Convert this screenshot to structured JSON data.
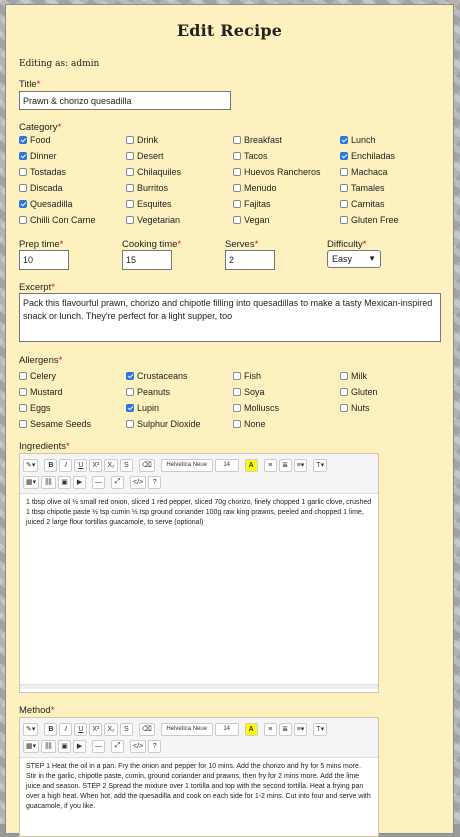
{
  "page_title": "Edit Recipe",
  "editing_as": "Editing as: admin",
  "title_field": {
    "label": "Title",
    "value": "Prawn & chorizo quesadilla"
  },
  "category": {
    "label": "Category",
    "items": [
      {
        "label": "Food",
        "checked": true
      },
      {
        "label": "Drink",
        "checked": false
      },
      {
        "label": "Breakfast",
        "checked": false
      },
      {
        "label": "Lunch",
        "checked": true
      },
      {
        "label": "Dinner",
        "checked": true
      },
      {
        "label": "Desert",
        "checked": false
      },
      {
        "label": "Tacos",
        "checked": false
      },
      {
        "label": "Enchiladas",
        "checked": true
      },
      {
        "label": "Tostadas",
        "checked": false
      },
      {
        "label": "Chilaquiles",
        "checked": false
      },
      {
        "label": "Huevos Rancheros",
        "checked": false
      },
      {
        "label": "Machaca",
        "checked": false
      },
      {
        "label": "Discada",
        "checked": false
      },
      {
        "label": "Burritos",
        "checked": false
      },
      {
        "label": "Menudo",
        "checked": false
      },
      {
        "label": "Tamales",
        "checked": false
      },
      {
        "label": "Quesadilla",
        "checked": true
      },
      {
        "label": "Esquites",
        "checked": false
      },
      {
        "label": "Fajitas",
        "checked": false
      },
      {
        "label": "Carnitas",
        "checked": false
      },
      {
        "label": "Chilli Con Carne",
        "checked": false
      },
      {
        "label": "Vegetarian",
        "checked": false
      },
      {
        "label": "Vegan",
        "checked": false
      },
      {
        "label": "Gluten Free",
        "checked": false
      }
    ]
  },
  "prep": {
    "label": "Prep time",
    "value": "10"
  },
  "cooking": {
    "label": "Cooking time",
    "value": "15"
  },
  "serves": {
    "label": "Serves",
    "value": "2"
  },
  "difficulty": {
    "label": "Difficulty",
    "value": "Easy"
  },
  "excerpt": {
    "label": "Excerpt",
    "value": "Pack this flavourful prawn, chorizo and chipotle filling into quesadillas to make a tasty Mexican-inspired snack or lunch. They're perfect for a light supper, too"
  },
  "allergens": {
    "label": "Allergens",
    "items": [
      {
        "label": "Celery",
        "checked": false
      },
      {
        "label": "Crustaceans",
        "checked": true
      },
      {
        "label": "Fish",
        "checked": false
      },
      {
        "label": "Milk",
        "checked": false
      },
      {
        "label": "Mustard",
        "checked": false
      },
      {
        "label": "Peanuts",
        "checked": false
      },
      {
        "label": "Soya",
        "checked": false
      },
      {
        "label": "Gluten",
        "checked": false
      },
      {
        "label": "Eggs",
        "checked": false
      },
      {
        "label": "Lupin",
        "checked": true
      },
      {
        "label": "Molluscs",
        "checked": false
      },
      {
        "label": "Nuts",
        "checked": false
      },
      {
        "label": "Sesame Seeds",
        "checked": false
      },
      {
        "label": "Sulphur Dioxide",
        "checked": false
      },
      {
        "label": "None",
        "checked": false
      }
    ]
  },
  "toolbar": {
    "font_name": "Helvetica Neue",
    "font_size": "14",
    "row1": [
      "magic",
      "B",
      "I",
      "U",
      "X²",
      "X₂",
      "S",
      "eraser",
      "font",
      "size",
      "A",
      "ul",
      "ol",
      "align",
      "T"
    ],
    "row2": [
      "table",
      "link",
      "image",
      "video",
      "hr",
      "fullscreen",
      "</>",
      "?"
    ]
  },
  "ingredients": {
    "label": "Ingredients",
    "value": "1 tbsp olive oil ½ small red onion, sliced 1 red pepper, sliced 70g chorizo, finely chopped 1 garlic clove, crushed 1 tbsp chipotle paste ½ tsp cumin ½ tsp ground coriander 100g raw king prawns, peeled and chopped 1 lime, juiced 2 large flour tortillas guacamole, to serve (optional)"
  },
  "method": {
    "label": "Method",
    "value": "STEP 1 Heat the oil in a pan. Fry the onion and pepper for 10 mins. Add the chorizo and fry for 5 mins more. Stir in the garlic, chipotle paste, cumin, ground coriander and prawns, then fry for 2 mins more. Add the lime juice and season. STEP 2 Spread the mixture over 1 tortilla and top with the second tortilla. Heat a frying pan over a high heat. When hot, add the quesadilla and cook on each side for 1-2 mins. Cut into four and serve with guacamole, if you like."
  }
}
